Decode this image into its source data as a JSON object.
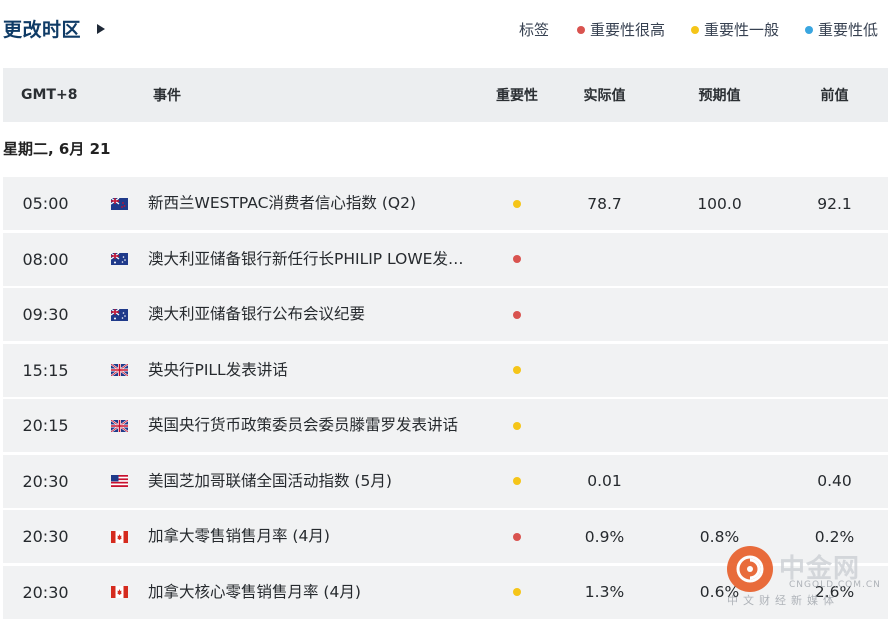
{
  "header": {
    "timezone_link": "更改时区",
    "legend_title": "标签",
    "legend": [
      {
        "label": "重要性很高",
        "color": "#d9534f"
      },
      {
        "label": "重要性一般",
        "color": "#f5c518"
      },
      {
        "label": "重要性低",
        "color": "#3aa6e0"
      }
    ]
  },
  "table": {
    "columns": {
      "timezone": "GMT+8",
      "event": "事件",
      "importance": "重要性",
      "actual": "实际值",
      "forecast": "预期值",
      "previous": "前值"
    },
    "date_label": "星期二, 6月 21",
    "rows": [
      {
        "time": "05:00",
        "country": "NZ",
        "event": "新西兰WESTPAC消费者信心指数 (Q2)",
        "importance": "medium",
        "actual": "78.7",
        "forecast": "100.0",
        "previous": "92.1"
      },
      {
        "time": "08:00",
        "country": "AU",
        "event": "澳大利亚储备银行新任行长PHILIP LOWE发…",
        "importance": "high",
        "actual": "",
        "forecast": "",
        "previous": ""
      },
      {
        "time": "09:30",
        "country": "AU",
        "event": "澳大利亚储备银行公布会议纪要",
        "importance": "high",
        "actual": "",
        "forecast": "",
        "previous": ""
      },
      {
        "time": "15:15",
        "country": "GB",
        "event": "英央行PILL发表讲话",
        "importance": "medium",
        "actual": "",
        "forecast": "",
        "previous": ""
      },
      {
        "time": "20:15",
        "country": "GB",
        "event": "英国央行货币政策委员会委员滕雷罗发表讲话",
        "importance": "medium",
        "actual": "",
        "forecast": "",
        "previous": ""
      },
      {
        "time": "20:30",
        "country": "US",
        "event": "美国芝加哥联储全国活动指数 (5月)",
        "importance": "medium",
        "actual": "0.01",
        "forecast": "",
        "previous": "0.40"
      },
      {
        "time": "20:30",
        "country": "CA",
        "event": "加拿大零售销售月率 (4月)",
        "importance": "high",
        "actual": "0.9%",
        "forecast": "0.8%",
        "previous": "0.2%"
      },
      {
        "time": "20:30",
        "country": "CA",
        "event": "加拿大核心零售销售月率 (4月)",
        "importance": "medium",
        "actual": "1.3%",
        "forecast": "0.6%",
        "previous": "2.6%"
      }
    ]
  },
  "colors": {
    "high": "#d9534f",
    "medium": "#f5c518",
    "low": "#3aa6e0",
    "title": "#0f3b66"
  },
  "watermark": {
    "name": "中金网",
    "domain": "CNGOLD.COM.CN",
    "tagline": "中文财经新媒体"
  }
}
